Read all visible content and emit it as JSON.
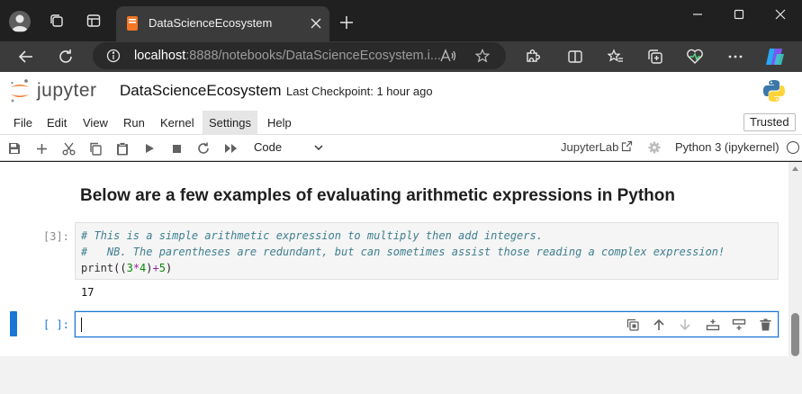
{
  "browser": {
    "tab_title": "DataScienceEcosystem",
    "url_host": "localhost",
    "url_rest": ":8888/notebooks/DataScienceEcosystem.i...",
    "icons": [
      "profile-avatar",
      "workspaces-icon",
      "tab-actions-icon",
      "notebook-favicon",
      "close-icon",
      "new-tab-icon",
      "minimize-icon",
      "maximize-icon",
      "window-close-icon",
      "back-icon",
      "refresh-icon",
      "site-info-icon",
      "read-aloud-icon",
      "favorite-icon",
      "extensions-icon",
      "split-screen-icon",
      "favorites-icon",
      "collections-icon",
      "browser-essentials-icon",
      "more-icon",
      "copilot-icon"
    ]
  },
  "jupyter": {
    "logo_text": "jupyter",
    "notebook_title": "DataScienceEcosystem",
    "checkpoint": "Last Checkpoint: 1 hour ago",
    "menu": [
      "File",
      "Edit",
      "View",
      "Run",
      "Kernel",
      "Settings",
      "Help"
    ],
    "active_menu": "Settings",
    "trusted": "Trusted",
    "toolbar": {
      "cell_type": "Code",
      "jupyterlab_link": "JupyterLab",
      "kernel": "Python 3 (ipykernel)"
    }
  },
  "cells": {
    "markdown_heading": "Below are a few examples of evaluating arithmetic expressions in Python",
    "code_prompt": "[3]:",
    "code_line_1": "# This is a simple arithmetic expression to multiply then add integers.",
    "code_line_2": "#   NB. The parentheses are redundant, but can sometimes assist those reading a complex expression!",
    "code_line_3": {
      "fn": "print",
      "open": "((",
      "n1": "3",
      "op1": "*",
      "n2": "4",
      "close1": ")",
      "op2": "+",
      "n3": "5",
      "close2": ")"
    },
    "output": "17",
    "empty_prompt": "[ ]:"
  },
  "colors": {
    "accent": "#1976d2",
    "jupyter_orange": "#f37726",
    "comment": "#3f7f8f",
    "number": "#0a8a0a",
    "operator": "#a020a0"
  }
}
